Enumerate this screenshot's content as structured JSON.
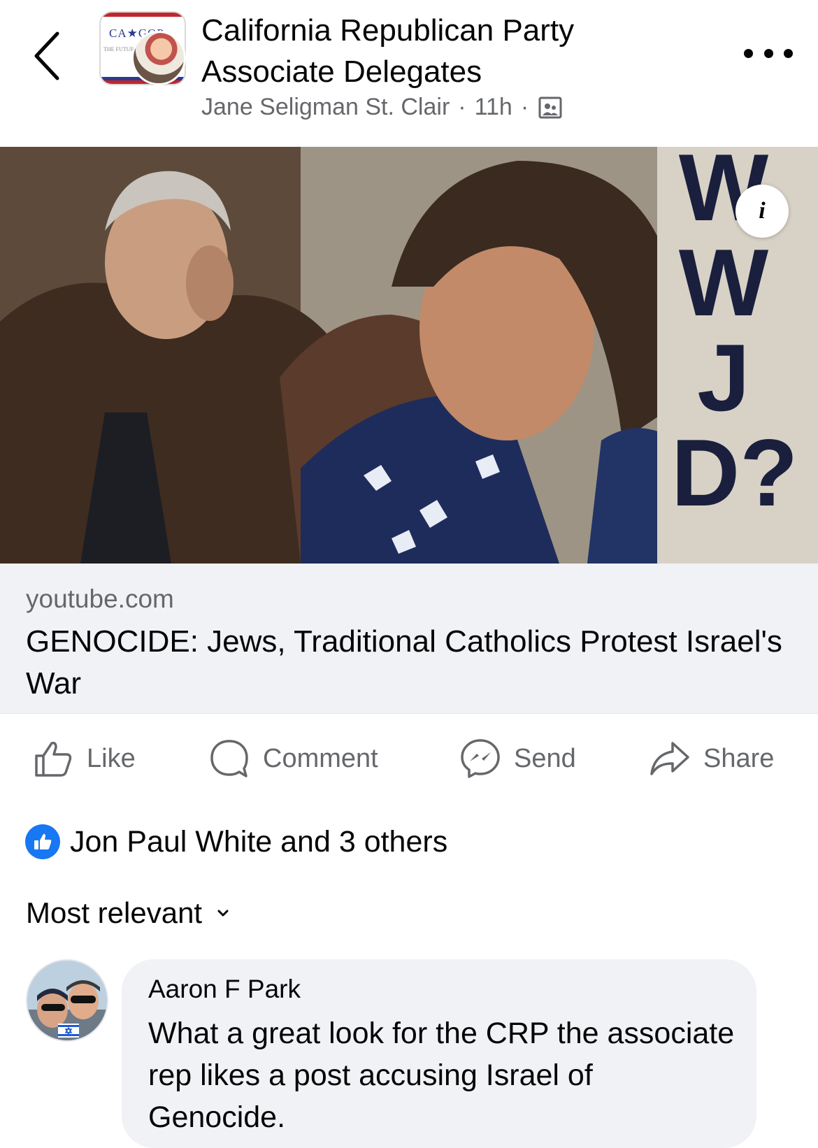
{
  "header": {
    "group_name": "California Republican Party Associate Delegates",
    "author": "Jane Seligman St. Clair",
    "time": "11h",
    "separator": "·",
    "logo_text": "CA★GOP",
    "logo_subtext": "THE FUTURE",
    "icons": {
      "back": "chevron-left-icon",
      "privacy": "group-privacy-icon",
      "more": "more-options-icon"
    }
  },
  "thumbnail": {
    "overlay_letters": [
      "W",
      "W",
      "J",
      "D?"
    ],
    "info_label": "i",
    "colors": {
      "letters": "#1a1f3d",
      "background": "#d7cfc2"
    }
  },
  "link": {
    "domain": "youtube.com",
    "title": "GENOCIDE: Jews, Traditional Catholics Protest Israel's War"
  },
  "actions": {
    "like": "Like",
    "comment": "Comment",
    "send": "Send",
    "share": "Share"
  },
  "reactions": {
    "summary": "Jon Paul White and 3 others",
    "color": "#1877f2"
  },
  "comments_sort": {
    "label": "Most relevant"
  },
  "comments": [
    {
      "author": "Aaron F Park",
      "text": "What a great look for the CRP the associate rep likes a post accusing Israel of Genocide."
    }
  ]
}
